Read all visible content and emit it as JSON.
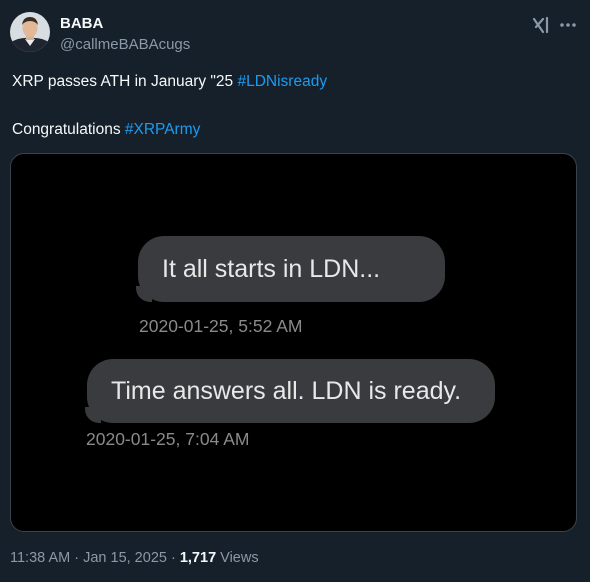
{
  "author": {
    "display_name": "BABA",
    "handle": "@callmeBABAcugs"
  },
  "tweet": {
    "line1_text": "XRP passes ATH in January \"25 ",
    "line1_hashtag": "#LDNisready",
    "line2_text": "Congratulations ",
    "line2_hashtag": "#XRPArmy"
  },
  "media": {
    "messages": [
      {
        "text": "It all starts in LDN...",
        "timestamp": "2020-01-25, 5:52 AM"
      },
      {
        "text": "Time answers all. LDN is ready.",
        "timestamp": "2020-01-25, 7:04 AM"
      }
    ]
  },
  "meta": {
    "time": "11:38 AM",
    "separator": " · ",
    "date": "Jan 15, 2025",
    "views_count": "1,717",
    "views_label": " Views"
  },
  "icons": {
    "grok": "grok-icon",
    "more": "more-icon"
  },
  "colors": {
    "background": "#15202b",
    "hashtag": "#1d9bf0",
    "secondary_text": "#8b98a5",
    "bubble": "#3a3b3e"
  }
}
